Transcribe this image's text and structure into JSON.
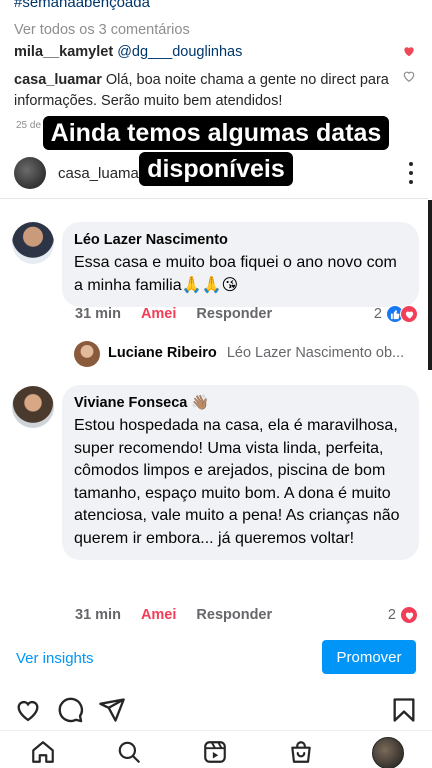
{
  "post": {
    "hashtag": "#semanaabençoada",
    "view_all_comments": "Ver todos os 3 comentários",
    "comments": [
      {
        "user": "mila__kamylet",
        "mention": "@dg___douglinhas",
        "text": ""
      },
      {
        "user": "casa_luamar",
        "text": "Olá, boa noite chama a gente no direct para informações. Serão muito bem atendidos!"
      }
    ],
    "date": "25 de ja",
    "caption_line1": "Ainda temos algumas datas",
    "caption_line2": "disponíveis",
    "author": "casa_luamar"
  },
  "fb": {
    "comments": [
      {
        "name": "Léo Lazer Nascimento",
        "text": "Essa casa e muito boa fiquei o ano novo com a minha familia🙏🙏😘",
        "time": "31 min",
        "love": "Amei",
        "reply": "Responder",
        "react_count": "2"
      },
      {
        "name": "Viviane Fonseca 👋🏽",
        "text": "Estou hospedada na casa, ela é maravilhosa, super recomendo! Uma vista linda, perfeita, cômodos limpos e arejados, piscina de bom tamanho, espaço muito bom. A dona é muito atenciosa, vale muito a pena! As crianças não querem ir embora... já queremos voltar!",
        "time": "31 min",
        "love": "Amei",
        "reply": "Responder",
        "react_count": "2"
      }
    ],
    "reply": {
      "name": "Luciane Ribeiro",
      "text": "Léo Lazer Nascimento ob..."
    }
  },
  "actions": {
    "insights": "Ver insights",
    "promote": "Promover"
  },
  "icons": {
    "like": "heart-icon",
    "comment": "comment-icon",
    "share": "send-icon",
    "save": "bookmark-icon",
    "home": "home-icon",
    "search": "search-icon",
    "reels": "reels-icon",
    "shop": "shop-icon"
  },
  "colors": {
    "accent": "#0095f6",
    "liked_heart": "#ed4956",
    "fb_love": "#f33e58",
    "fb_like": "#1877f2"
  }
}
